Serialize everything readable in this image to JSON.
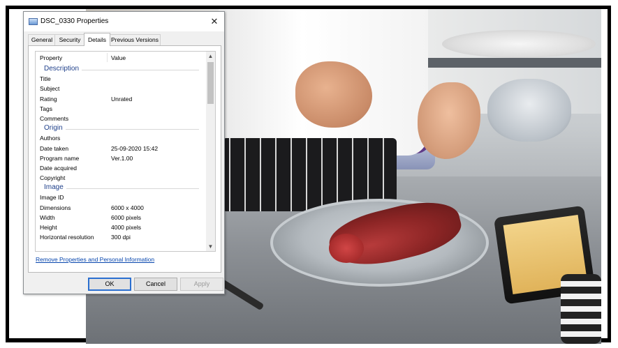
{
  "dialog": {
    "title": "DSC_0330 Properties",
    "close_glyph": "✕",
    "tabs": [
      {
        "label": "General"
      },
      {
        "label": "Security"
      },
      {
        "label": "Details"
      },
      {
        "label": "Previous Versions"
      }
    ],
    "active_tab": "Details",
    "list": {
      "header": {
        "property": "Property",
        "value": "Value"
      },
      "groups": {
        "description": "Description",
        "origin": "Origin",
        "image": "Image"
      },
      "rows": {
        "title": {
          "k": "Title",
          "v": ""
        },
        "subject": {
          "k": "Subject",
          "v": ""
        },
        "rating": {
          "k": "Rating",
          "v": "Unrated"
        },
        "tags": {
          "k": "Tags",
          "v": ""
        },
        "comments": {
          "k": "Comments",
          "v": ""
        },
        "authors": {
          "k": "Authors",
          "v": ""
        },
        "date_taken": {
          "k": "Date taken",
          "v": "25-09-2020 15:42"
        },
        "program_name": {
          "k": "Program name",
          "v": "Ver.1.00"
        },
        "date_acquired": {
          "k": "Date acquired",
          "v": ""
        },
        "copyright": {
          "k": "Copyright",
          "v": ""
        },
        "image_id": {
          "k": "Image ID",
          "v": ""
        },
        "dimensions": {
          "k": "Dimensions",
          "v": "6000 x 4000"
        },
        "width": {
          "k": "Width",
          "v": "6000 pixels"
        },
        "height": {
          "k": "Height",
          "v": "4000 pixels"
        },
        "horizontal_resolution": {
          "k": "Horizontal resolution",
          "v": "300 dpi"
        }
      }
    },
    "remove_link": "Remove Properties and Personal Information",
    "buttons": {
      "ok": "OK",
      "cancel": "Cancel",
      "apply": "Apply"
    }
  },
  "icons": {
    "window": "image-file-icon",
    "scroll_up": "▲",
    "scroll_down": "▼"
  },
  "colors": {
    "group_heading": "#1e3f8a",
    "link": "#0645ad",
    "frame": "#000000"
  }
}
